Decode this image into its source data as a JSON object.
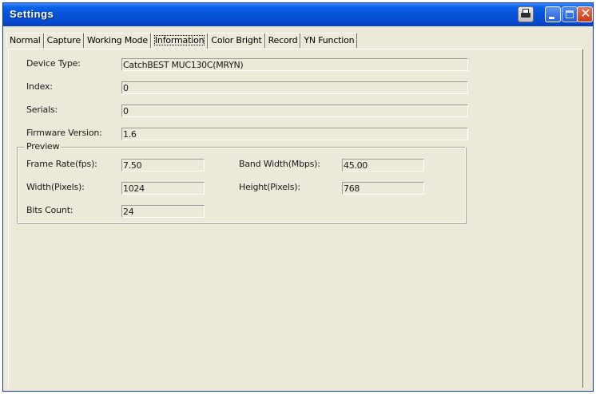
{
  "window": {
    "title": "Settings"
  },
  "tabs": [
    {
      "label": "Normal"
    },
    {
      "label": "Capture"
    },
    {
      "label": "Working Mode"
    },
    {
      "label": "Information"
    },
    {
      "label": "Color Bright"
    },
    {
      "label": "Record"
    },
    {
      "label": "YN Function"
    }
  ],
  "active_tab": "Information",
  "info": {
    "device_type": {
      "label": "Device Type:",
      "value": "CatchBEST MUC130C(MRYN)"
    },
    "index": {
      "label": "Index:",
      "value": "0"
    },
    "serials": {
      "label": "Serials:",
      "value": "0"
    },
    "firmware": {
      "label": "Firmware Version:",
      "value": "1.6"
    }
  },
  "preview": {
    "legend": "Preview",
    "frame_rate": {
      "label": "Frame Rate(fps):",
      "value": "7.50"
    },
    "band_width": {
      "label": "Band Width(Mbps):",
      "value": "45.00"
    },
    "width": {
      "label": "Width(Pixels):",
      "value": "1024"
    },
    "height": {
      "label": "Height(Pixels):",
      "value": "768"
    },
    "bits_count": {
      "label": "Bits Count:",
      "value": "24"
    }
  },
  "icons": {
    "print": "printer-icon",
    "minimize": "minimize-icon",
    "maximize": "maximize-icon",
    "close": "close-icon"
  },
  "colors": {
    "titlebar": "#0552d6",
    "window_bg": "#ece9d8",
    "close_button": "#c83914"
  }
}
